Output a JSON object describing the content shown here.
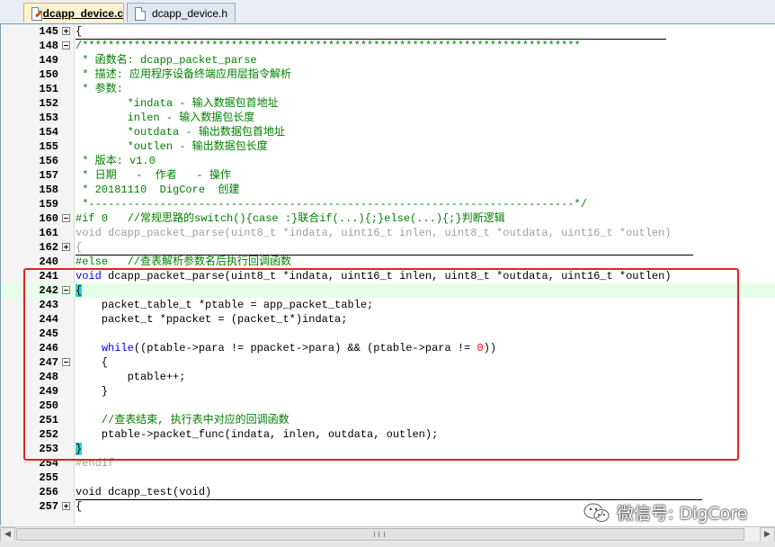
{
  "tabs": [
    {
      "label": "dcapp_device.c",
      "active": true
    },
    {
      "label": "dcapp_device.h",
      "active": false
    }
  ],
  "lines": [
    {
      "num": "145",
      "fold": "plus",
      "parts": [
        {
          "t": "{",
          "c": ""
        }
      ]
    },
    {
      "num": "148",
      "fold": "minus",
      "parts": [
        {
          "t": "/*****************************************************************************",
          "c": "cmt"
        }
      ]
    },
    {
      "num": "149",
      "parts": [
        {
          "t": " * 函数名: dcapp_packet_parse",
          "c": "cmt"
        }
      ]
    },
    {
      "num": "150",
      "parts": [
        {
          "t": " * 描述: 应用程序设备终端应用层指令解析",
          "c": "cmt"
        }
      ]
    },
    {
      "num": "151",
      "parts": [
        {
          "t": " * 参数:",
          "c": "cmt"
        }
      ]
    },
    {
      "num": "152",
      "parts": [
        {
          "t": "        *indata - 输入数据包首地址",
          "c": "cmt"
        }
      ]
    },
    {
      "num": "153",
      "parts": [
        {
          "t": "        inlen - 输入数据包长度",
          "c": "cmt"
        }
      ]
    },
    {
      "num": "154",
      "parts": [
        {
          "t": "        *outdata - 输出数据包首地址",
          "c": "cmt"
        }
      ]
    },
    {
      "num": "155",
      "parts": [
        {
          "t": "        *outlen - 输出数据包长度",
          "c": "cmt"
        }
      ]
    },
    {
      "num": "156",
      "parts": [
        {
          "t": " * 版本: v1.0",
          "c": "cmt"
        }
      ]
    },
    {
      "num": "157",
      "parts": [
        {
          "t": " * 日期   -  作者   - 操作",
          "c": "cmt"
        }
      ]
    },
    {
      "num": "158",
      "parts": [
        {
          "t": " * 20181110  DigCore  创建",
          "c": "cmt"
        }
      ]
    },
    {
      "num": "159",
      "parts": [
        {
          "t": " *---------------------------------------------------------------------------*/",
          "c": "cmt"
        }
      ]
    },
    {
      "num": "160",
      "fold": "minus",
      "parts": [
        {
          "t": "#if 0   //常规思路的switch(){case :}联合if(...){;}else(...){;}判断逻辑",
          "c": "cmt"
        }
      ]
    },
    {
      "num": "161",
      "parts": [
        {
          "t": "void dcapp_packet_parse(uint8_t *indata, uint16_t inlen, uint8_t *outdata, uint16_t *outlen)",
          "c": "grey"
        }
      ]
    },
    {
      "num": "162",
      "fold": "plus",
      "parts": [
        {
          "t": "{",
          "c": "grey"
        }
      ]
    },
    {
      "num": "240",
      "parts": [
        {
          "t": "#else   //查表解析参数名后执行回调函数",
          "c": "cmt"
        }
      ]
    },
    {
      "num": "241",
      "parts": [
        {
          "t": "void",
          "c": "kw"
        },
        {
          "t": " dcapp_packet_parse(uint8_t *indata, uint16_t inlen, uint8_t *outdata, uint16_t *outlen)",
          "c": ""
        }
      ]
    },
    {
      "num": "242",
      "fold": "minus",
      "highlight": true,
      "parts": [
        {
          "t": "{",
          "c": "brace"
        }
      ]
    },
    {
      "num": "243",
      "parts": [
        {
          "t": "    packet_table_t *ptable = app_packet_table;",
          "c": ""
        }
      ]
    },
    {
      "num": "244",
      "parts": [
        {
          "t": "    packet_t *ppacket = (packet_t*)indata;",
          "c": ""
        }
      ]
    },
    {
      "num": "245",
      "parts": [
        {
          "t": "",
          "c": ""
        }
      ]
    },
    {
      "num": "246",
      "parts": [
        {
          "t": "    ",
          "c": ""
        },
        {
          "t": "while",
          "c": "kw"
        },
        {
          "t": "((ptable->para != ppacket->para) && (ptable->para != ",
          "c": ""
        },
        {
          "t": "0",
          "c": "num"
        },
        {
          "t": "))",
          "c": ""
        }
      ]
    },
    {
      "num": "247",
      "fold": "minus",
      "parts": [
        {
          "t": "    {",
          "c": ""
        }
      ]
    },
    {
      "num": "248",
      "parts": [
        {
          "t": "        ptable++;",
          "c": ""
        }
      ]
    },
    {
      "num": "249",
      "parts": [
        {
          "t": "    }",
          "c": ""
        }
      ]
    },
    {
      "num": "250",
      "parts": [
        {
          "t": "",
          "c": ""
        }
      ]
    },
    {
      "num": "251",
      "parts": [
        {
          "t": "    //查表结束, 执行表中对应的回调函数",
          "c": "cmt"
        }
      ]
    },
    {
      "num": "252",
      "parts": [
        {
          "t": "    ptable->packet_func(indata, inlen, outdata, outlen);",
          "c": ""
        }
      ]
    },
    {
      "num": "253",
      "parts": [
        {
          "t": "}",
          "c": "brace"
        }
      ]
    },
    {
      "num": "254",
      "parts": [
        {
          "t": "#endif",
          "c": "grey"
        }
      ]
    },
    {
      "num": "255",
      "parts": [
        {
          "t": "",
          "c": ""
        }
      ]
    },
    {
      "num": "256",
      "parts": [
        {
          "t": "void dcapp_test(void)",
          "c": ""
        }
      ]
    },
    {
      "num": "257",
      "fold": "plus",
      "parts": [
        {
          "t": "{",
          "c": ""
        }
      ]
    }
  ],
  "watermark": {
    "text": "微信号: DigCore"
  },
  "scrollbar": {
    "left_arrow": "◀",
    "right_arrow": "▶"
  },
  "colors": {
    "comment": "#008000",
    "keyword": "#0000ff",
    "number": "#ff0000",
    "brace_match": "#2dd3d3",
    "current_line": "#e6ffe9",
    "highlight_frame": "#e2241b"
  }
}
